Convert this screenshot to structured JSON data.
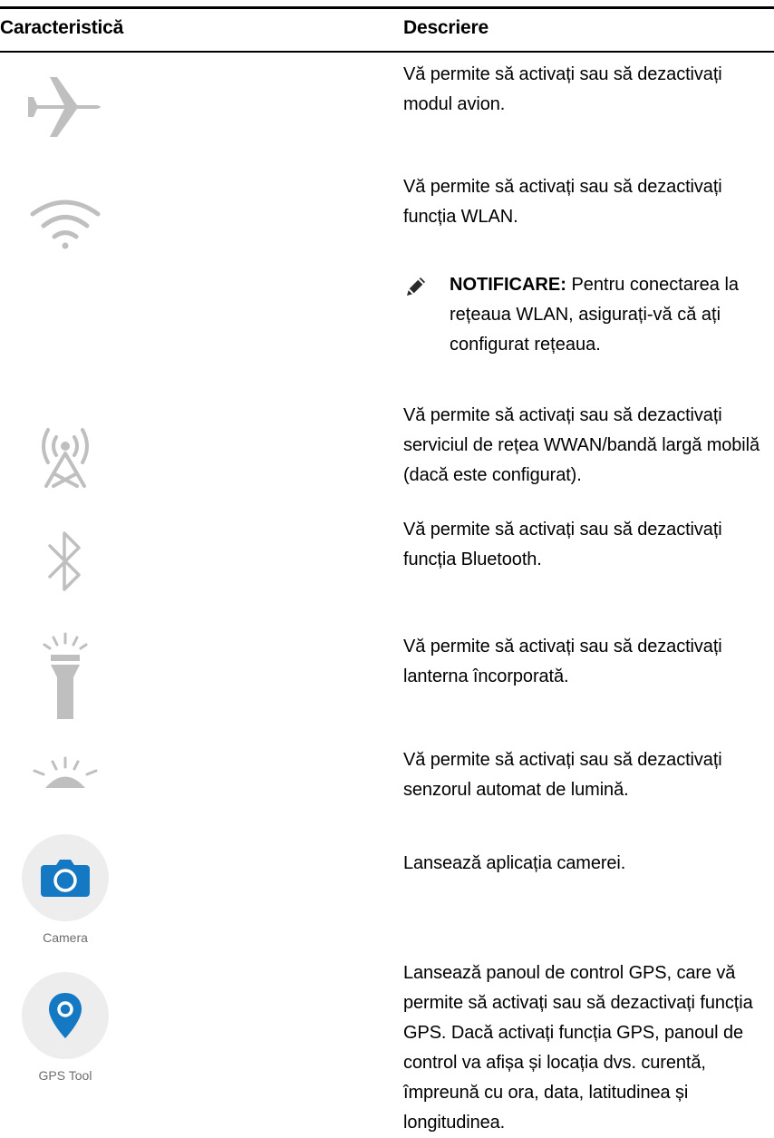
{
  "table": {
    "header": {
      "feature": "Caracteristică",
      "description": "Descriere"
    },
    "rows": [
      {
        "icon": "airplane-icon",
        "description": "Vă permite să activați sau să dezactivați modul avion."
      },
      {
        "icon": "wifi-icon",
        "description": "Vă permite să activați sau să dezactivați funcția WLAN.",
        "note": {
          "label": "NOTIFICARE:",
          "text": " Pentru conectarea la rețeaua WLAN, asigurați-vă că ați configurat rețeaua."
        }
      },
      {
        "icon": "cellular-antenna-icon",
        "description": "Vă permite să activați sau să dezactivați serviciul de rețea WWAN/bandă largă mobilă (dacă este configurat)."
      },
      {
        "icon": "bluetooth-icon",
        "description": "Vă permite să activați sau să dezactivați funcția Bluetooth."
      },
      {
        "icon": "flashlight-icon",
        "description": "Vă permite să activați sau să dezactivați lanterna încorporată."
      },
      {
        "icon": "ambient-light-sensor-icon",
        "description": "Vă permite să activați sau să dezactivați senzorul automat de lumină."
      },
      {
        "icon": "camera-icon",
        "caption": "Camera",
        "description": "Lansează aplicația camerei."
      },
      {
        "icon": "location-pin-icon",
        "caption": "GPS Tool",
        "description": "Lansează panoul de control GPS, care vă permite să activați sau să dezactivați funcția GPS. Dacă activați funcția GPS, panoul de control va afișa și locația dvs. curentă, împreună cu ora, data, latitudinea și longitudinea."
      }
    ]
  },
  "colors": {
    "icon_gray": "#bfbfbf",
    "tile_bg": "#ededed",
    "accent_blue": "#1479c2",
    "caption_gray": "#6d6d6d"
  }
}
